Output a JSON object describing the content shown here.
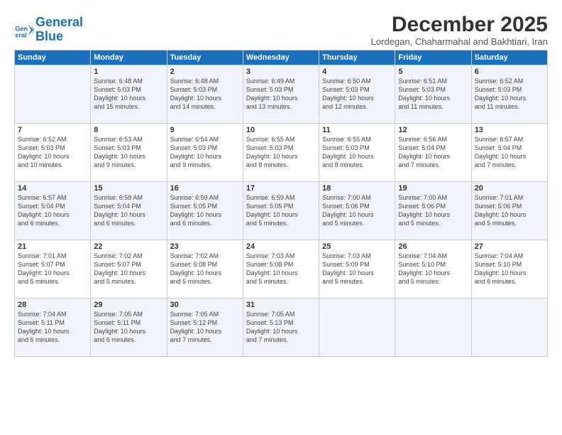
{
  "header": {
    "logo": "GeneralBlue",
    "month": "December 2025",
    "location": "Lordegan, Chaharmahal and Bakhtiari, Iran"
  },
  "weekdays": [
    "Sunday",
    "Monday",
    "Tuesday",
    "Wednesday",
    "Thursday",
    "Friday",
    "Saturday"
  ],
  "weeks": [
    [
      {
        "day": "",
        "info": ""
      },
      {
        "day": "1",
        "info": "Sunrise: 6:48 AM\nSunset: 5:03 PM\nDaylight: 10 hours\nand 15 minutes."
      },
      {
        "day": "2",
        "info": "Sunrise: 6:48 AM\nSunset: 5:03 PM\nDaylight: 10 hours\nand 14 minutes."
      },
      {
        "day": "3",
        "info": "Sunrise: 6:49 AM\nSunset: 5:03 PM\nDaylight: 10 hours\nand 13 minutes."
      },
      {
        "day": "4",
        "info": "Sunrise: 6:50 AM\nSunset: 5:03 PM\nDaylight: 10 hours\nand 12 minutes."
      },
      {
        "day": "5",
        "info": "Sunrise: 6:51 AM\nSunset: 5:03 PM\nDaylight: 10 hours\nand 11 minutes."
      },
      {
        "day": "6",
        "info": "Sunrise: 6:52 AM\nSunset: 5:03 PM\nDaylight: 10 hours\nand 11 minutes."
      }
    ],
    [
      {
        "day": "7",
        "info": "Sunrise: 6:52 AM\nSunset: 5:03 PM\nDaylight: 10 hours\nand 10 minutes."
      },
      {
        "day": "8",
        "info": "Sunrise: 6:53 AM\nSunset: 5:03 PM\nDaylight: 10 hours\nand 9 minutes."
      },
      {
        "day": "9",
        "info": "Sunrise: 6:54 AM\nSunset: 5:03 PM\nDaylight: 10 hours\nand 9 minutes."
      },
      {
        "day": "10",
        "info": "Sunrise: 6:55 AM\nSunset: 5:03 PM\nDaylight: 10 hours\nand 8 minutes."
      },
      {
        "day": "11",
        "info": "Sunrise: 6:55 AM\nSunset: 5:03 PM\nDaylight: 10 hours\nand 8 minutes."
      },
      {
        "day": "12",
        "info": "Sunrise: 6:56 AM\nSunset: 5:04 PM\nDaylight: 10 hours\nand 7 minutes."
      },
      {
        "day": "13",
        "info": "Sunrise: 6:57 AM\nSunset: 5:04 PM\nDaylight: 10 hours\nand 7 minutes."
      }
    ],
    [
      {
        "day": "14",
        "info": "Sunrise: 6:57 AM\nSunset: 5:04 PM\nDaylight: 10 hours\nand 6 minutes."
      },
      {
        "day": "15",
        "info": "Sunrise: 6:58 AM\nSunset: 5:04 PM\nDaylight: 10 hours\nand 6 minutes."
      },
      {
        "day": "16",
        "info": "Sunrise: 6:59 AM\nSunset: 5:05 PM\nDaylight: 10 hours\nand 6 minutes."
      },
      {
        "day": "17",
        "info": "Sunrise: 6:59 AM\nSunset: 5:05 PM\nDaylight: 10 hours\nand 5 minutes."
      },
      {
        "day": "18",
        "info": "Sunrise: 7:00 AM\nSunset: 5:06 PM\nDaylight: 10 hours\nand 5 minutes."
      },
      {
        "day": "19",
        "info": "Sunrise: 7:00 AM\nSunset: 5:06 PM\nDaylight: 10 hours\nand 5 minutes."
      },
      {
        "day": "20",
        "info": "Sunrise: 7:01 AM\nSunset: 5:06 PM\nDaylight: 10 hours\nand 5 minutes."
      }
    ],
    [
      {
        "day": "21",
        "info": "Sunrise: 7:01 AM\nSunset: 5:07 PM\nDaylight: 10 hours\nand 5 minutes."
      },
      {
        "day": "22",
        "info": "Sunrise: 7:02 AM\nSunset: 5:07 PM\nDaylight: 10 hours\nand 5 minutes."
      },
      {
        "day": "23",
        "info": "Sunrise: 7:02 AM\nSunset: 5:08 PM\nDaylight: 10 hours\nand 5 minutes."
      },
      {
        "day": "24",
        "info": "Sunrise: 7:03 AM\nSunset: 5:08 PM\nDaylight: 10 hours\nand 5 minutes."
      },
      {
        "day": "25",
        "info": "Sunrise: 7:03 AM\nSunset: 5:09 PM\nDaylight: 10 hours\nand 5 minutes."
      },
      {
        "day": "26",
        "info": "Sunrise: 7:04 AM\nSunset: 5:10 PM\nDaylight: 10 hours\nand 5 minutes."
      },
      {
        "day": "27",
        "info": "Sunrise: 7:04 AM\nSunset: 5:10 PM\nDaylight: 10 hours\nand 6 minutes."
      }
    ],
    [
      {
        "day": "28",
        "info": "Sunrise: 7:04 AM\nSunset: 5:11 PM\nDaylight: 10 hours\nand 6 minutes."
      },
      {
        "day": "29",
        "info": "Sunrise: 7:05 AM\nSunset: 5:11 PM\nDaylight: 10 hours\nand 6 minutes."
      },
      {
        "day": "30",
        "info": "Sunrise: 7:05 AM\nSunset: 5:12 PM\nDaylight: 10 hours\nand 7 minutes."
      },
      {
        "day": "31",
        "info": "Sunrise: 7:05 AM\nSunset: 5:13 PM\nDaylight: 10 hours\nand 7 minutes."
      },
      {
        "day": "",
        "info": ""
      },
      {
        "day": "",
        "info": ""
      },
      {
        "day": "",
        "info": ""
      }
    ]
  ]
}
